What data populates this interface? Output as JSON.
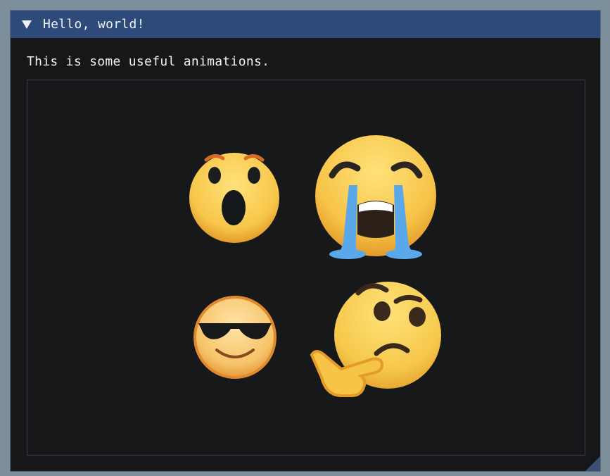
{
  "window": {
    "title": "Hello, world!",
    "body_text": "This is some useful animations."
  },
  "icons": {
    "collapse": "triangle-down-icon",
    "emojis": [
      "astonished-face-icon",
      "loudly-crying-face-icon",
      "sunglasses-face-icon",
      "thinking-face-icon"
    ],
    "resize": "resize-grip-icon"
  },
  "colors": {
    "title_bar": "#2e4a7b",
    "window_bg": "#161719",
    "desktop_bg": "#7d8f9b",
    "text": "#f1f1f1"
  }
}
